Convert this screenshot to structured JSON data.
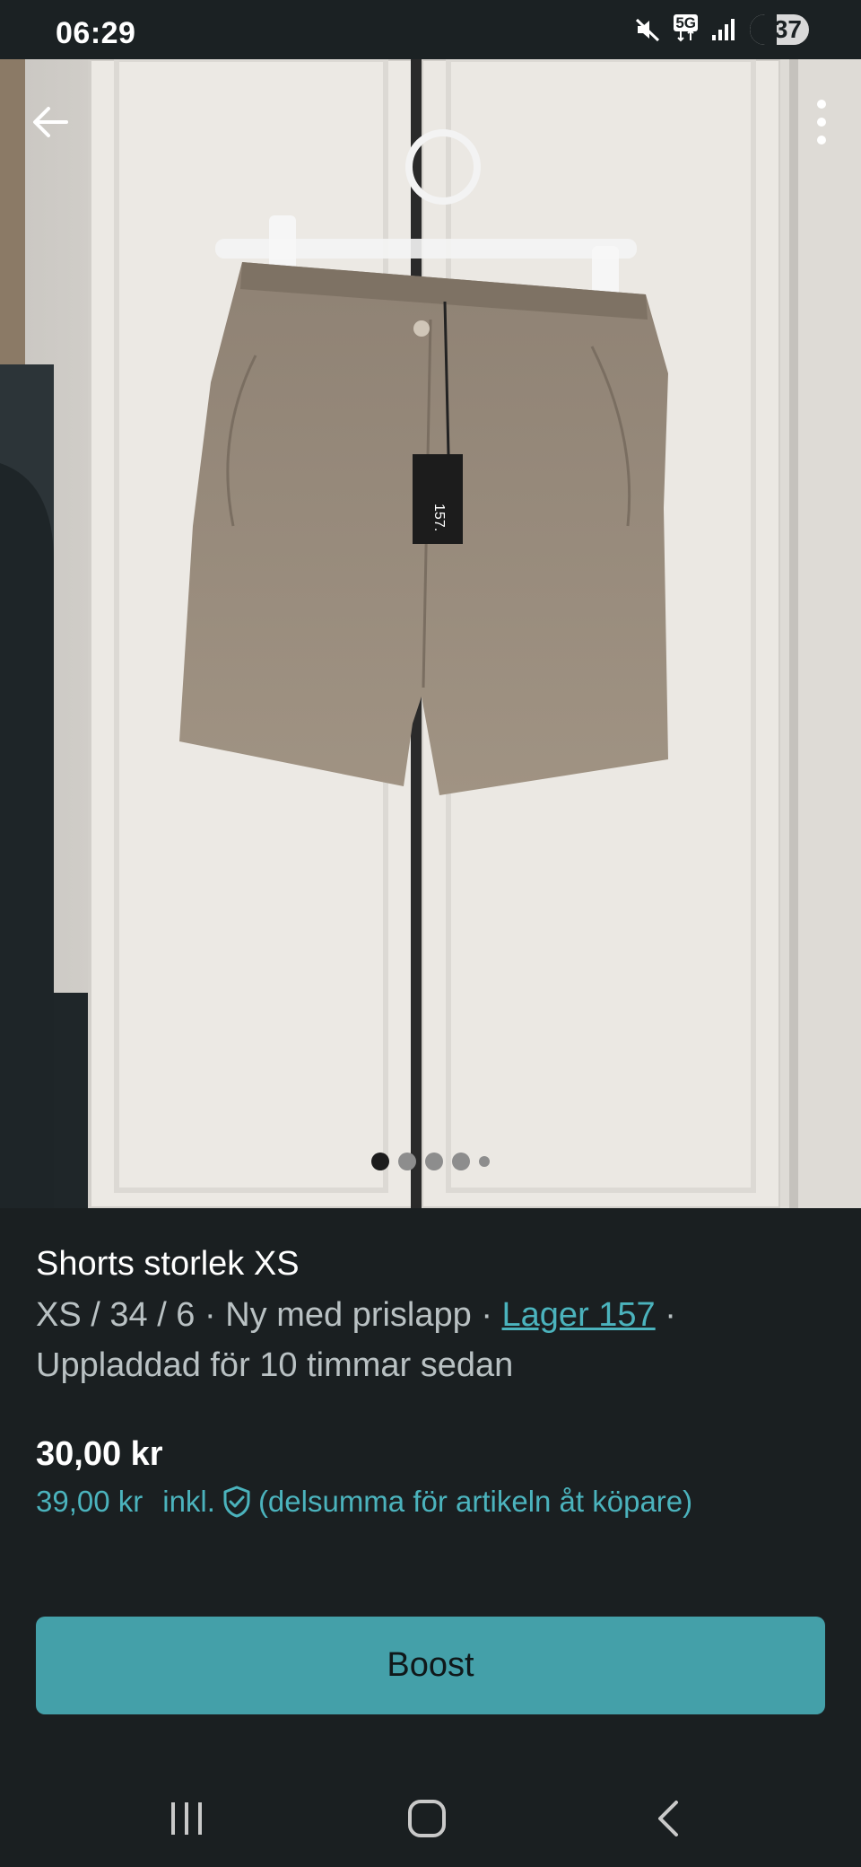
{
  "status_bar": {
    "time": "06:29",
    "network": "5G",
    "battery": "37",
    "icons": [
      "mute-icon",
      "network-5g-icon",
      "signal-icon",
      "battery-icon"
    ]
  },
  "listing": {
    "photo_alt": "Shorts storlek XS",
    "photo_count": 5,
    "current_photo": 1,
    "title": "Shorts storlek XS",
    "meta_prefix": "XS / 34 / 6 · Ny med prislapp · ",
    "brand": "Lager 157",
    "meta_suffix": " · ",
    "uploaded": "Uppladdad för 10 timmar sedan",
    "price": "30,00 kr",
    "price_incl_amount": "39,00 kr",
    "price_incl_label": "inkl.",
    "price_incl_note": "(delsumma för artikeln åt köpare)"
  },
  "actions": {
    "boost_label": "Boost"
  },
  "colors": {
    "accent": "#4bb3bd",
    "button": "#44a0a9",
    "background": "#1a1f21"
  }
}
